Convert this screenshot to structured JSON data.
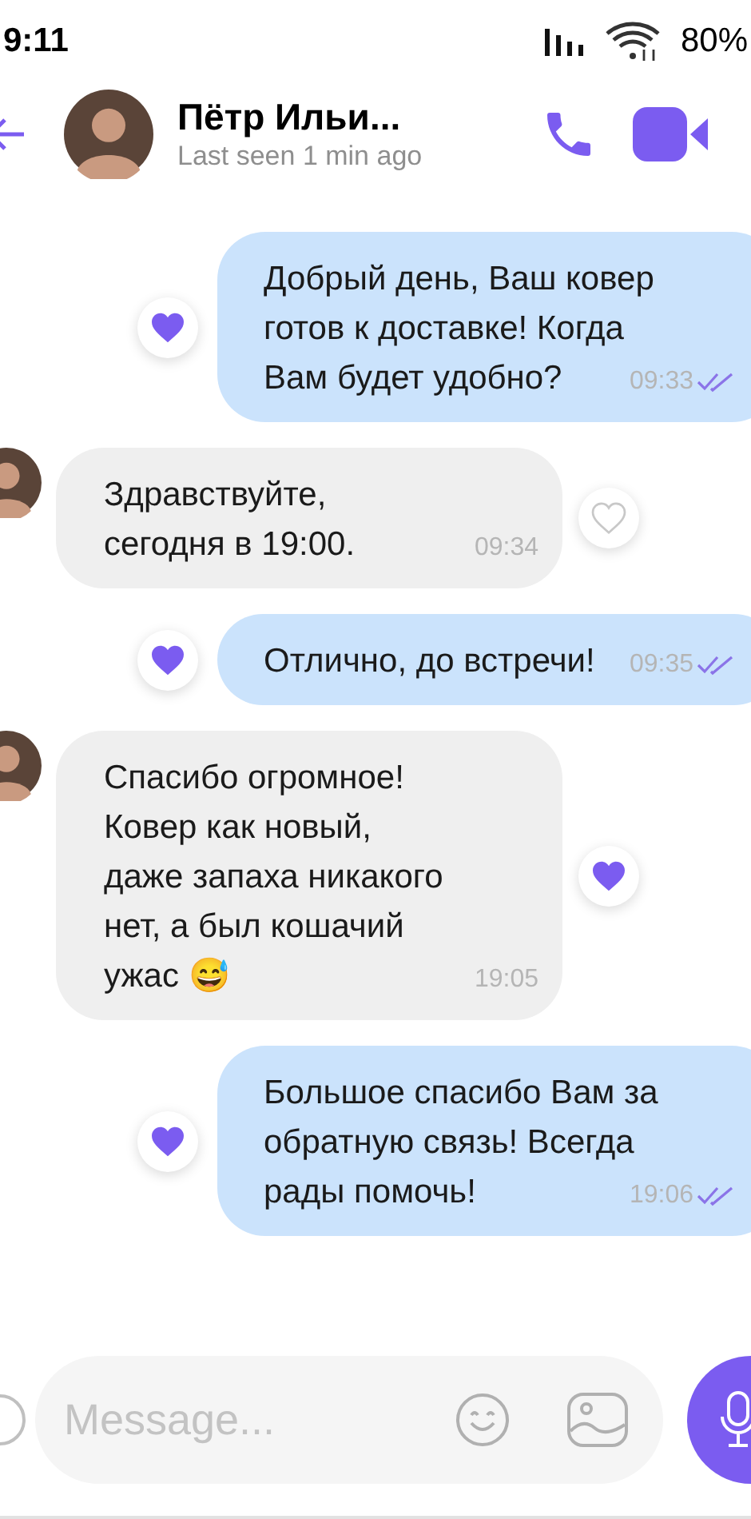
{
  "status_bar": {
    "time": "9:11",
    "battery": "80%"
  },
  "header": {
    "name": "Пётр Ильи...",
    "status": "Last seen 1 min ago"
  },
  "messages": [
    {
      "kind": "outgoing",
      "lines": [
        "Добрый день, Ваш ковер",
        "готов к доставке! Когда",
        "Вам будет удобно?"
      ],
      "time": "09:33",
      "liked": true,
      "read": true
    },
    {
      "kind": "incoming",
      "lines": [
        "Здравствуйте,",
        "сегодня в 19:00."
      ],
      "time": "09:34",
      "liked": false
    },
    {
      "kind": "outgoing",
      "lines": [
        "Отлично, до встречи!"
      ],
      "time": "09:35",
      "liked": true,
      "read": true
    },
    {
      "kind": "incoming",
      "lines": [
        "Спасибо огромное!",
        "Ковер как новый,",
        "даже запаха никакого",
        "нет, а был кошачий",
        "ужас 😅"
      ],
      "time": "19:05",
      "liked": true
    },
    {
      "kind": "outgoing",
      "lines": [
        "Большое спасибо Вам за",
        "обратную связь! Всегда",
        "рады помочь!"
      ],
      "time": "19:06",
      "liked": true,
      "read": true
    }
  ],
  "composer": {
    "placeholder": "Message..."
  }
}
